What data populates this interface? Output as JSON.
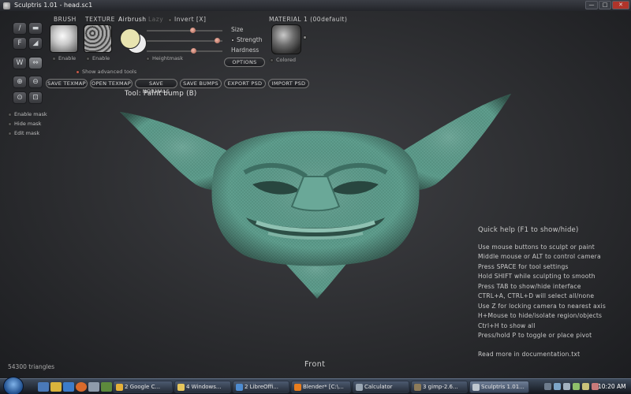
{
  "window": {
    "title": "Sculptris 1.01 - head.sc1",
    "min": "—",
    "max": "□",
    "close": "✕"
  },
  "tools": [
    {
      "label": "/",
      "name": "draw"
    },
    {
      "label": "▬",
      "name": "flatten"
    },
    {
      "label": "F",
      "name": "crease"
    },
    {
      "label": "◢",
      "name": "inflate"
    },
    {
      "label": "W",
      "name": "pinch"
    },
    {
      "label": "⇔",
      "name": "grab"
    },
    {
      "label": "⊕",
      "name": "smooth"
    },
    {
      "label": "⊖",
      "name": "reduce"
    },
    {
      "label": "⊙",
      "name": "rotate"
    },
    {
      "label": "⊡",
      "name": "scale"
    }
  ],
  "brush": {
    "label": "BRUSH",
    "enable": "Enable"
  },
  "texture": {
    "label": "TEXTURE",
    "enable": "Enable"
  },
  "airbrush": "Airbrush",
  "lazy": "Lazy",
  "invert": "Invert [X]",
  "heightmask": "Heightmask",
  "show_advanced": "Show advanced tools",
  "sliders": {
    "size": "Size",
    "strength": "Strength",
    "hardness": "Hardness",
    "size_value": 0.62,
    "strength_value": 0.97,
    "hardness_value": 0.63
  },
  "options_btn": "OPTIONS",
  "material": {
    "label": "MATERIAL 1 (00default)",
    "colored": "Colored"
  },
  "actions": [
    "SAVE TEXMAP",
    "OPEN TEXMAP",
    "SAVE NORMALS",
    "SAVE BUMPS",
    "EXPORT PSD",
    "IMPORT PSD"
  ],
  "mask": [
    "Enable mask",
    "Hide mask",
    "Edit mask"
  ],
  "tool_text": "Tool: Paint bump (B)",
  "quickhelp": {
    "title": "Quick help (F1 to show/hide)",
    "lines": [
      "Use mouse buttons to sculpt or paint",
      "Middle mouse or ALT to control camera",
      "Press SPACE for tool settings",
      "Hold SHIFT while sculpting to smooth",
      "Press TAB to show/hide interface",
      "CTRL+A, CTRL+D will select all/none",
      "Use Z for locking camera to nearest axis",
      "H+Mouse to hide/isolate region/objects",
      "Ctrl+H to show all",
      "Press/hold P to toggle or place pivot"
    ],
    "footer": "Read more in documentation.txt"
  },
  "triangles": "54300 triangles",
  "view": "Front",
  "taskbar": {
    "tasks": [
      {
        "label": "2 Google C...",
        "icon_color": "#e5b13a"
      },
      {
        "label": "4 Windows...",
        "icon_color": "#e6c65c"
      },
      {
        "label": "2 LibreOffi...",
        "icon_color": "#4e8cd1"
      },
      {
        "label": "Blender* [C:\\...",
        "icon_color": "#e87d1e"
      },
      {
        "label": "Calculator",
        "icon_color": "#9aa6b3"
      },
      {
        "label": "3 gimp-2.6...",
        "icon_color": "#8d7b5a"
      },
      {
        "label": "Sculptris 1.01...",
        "icon_color": "#bfc7cf"
      }
    ],
    "clock": "10:20 AM"
  }
}
